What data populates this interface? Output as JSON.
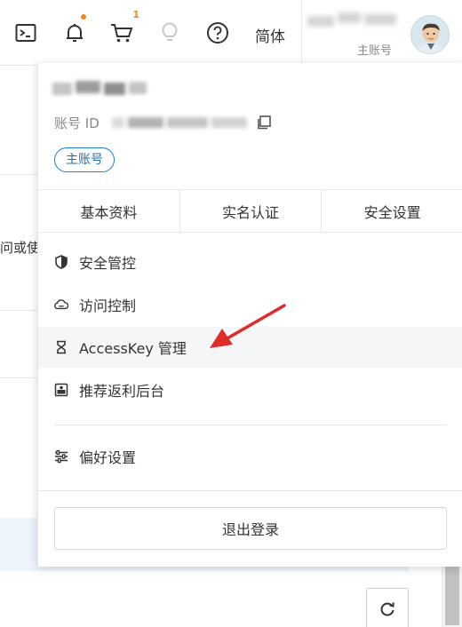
{
  "topbar": {
    "icons": [
      "terminal-icon",
      "bell-icon",
      "cart-icon",
      "lightbulb-icon",
      "help-icon"
    ],
    "cart_badge": "1",
    "language": "简体",
    "account_type": "主账号"
  },
  "dropdown": {
    "account_id_label": "账号 ID",
    "main_account_tag": "主账号",
    "tabs": [
      "基本资料",
      "实名认证",
      "安全设置"
    ],
    "menu": [
      {
        "label": "安全管控",
        "icon": "shield-icon"
      },
      {
        "label": "访问控制",
        "icon": "cloud-icon"
      },
      {
        "label": "AccessKey 管理",
        "icon": "key-icon"
      },
      {
        "label": "推荐返利后台",
        "icon": "rebate-icon"
      },
      {
        "label": "偏好设置",
        "icon": "sliders-icon"
      }
    ],
    "logout": "退出登录"
  },
  "background": {
    "partial_text": "问或使"
  },
  "colors": {
    "accent_blue": "#1f7ccd",
    "notice_orange": "#f5831f",
    "arrow_red": "#e02b2b",
    "hover_bg": "#f4f6f8"
  }
}
